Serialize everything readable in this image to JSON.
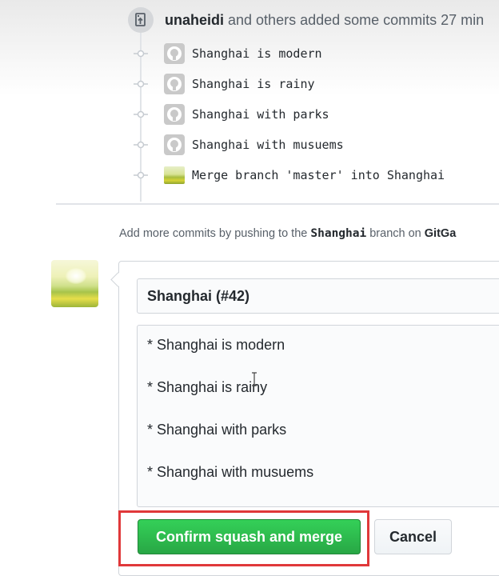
{
  "timeline": {
    "event_user": "unaheidi",
    "event_text": " and others added some commits 27 min",
    "commits": [
      {
        "message": "Shanghai is modern",
        "avatar": "github-octocat-icon"
      },
      {
        "message": "Shanghai is rainy",
        "avatar": "github-octocat-icon"
      },
      {
        "message": "Shanghai with parks",
        "avatar": "github-octocat-icon"
      },
      {
        "message": "Shanghai with musuems",
        "avatar": "github-octocat-icon"
      },
      {
        "message": "Merge branch 'master' into Shanghai",
        "avatar": "user-photo"
      }
    ]
  },
  "hint": {
    "prefix": "Add more commits by pushing to the ",
    "branch": "Shanghai",
    "middle": " branch on ",
    "remote": "GitGa"
  },
  "merge_form": {
    "title_value": "Shanghai (#42)",
    "body_lines": [
      "* Shanghai is modern",
      "* Shanghai is rainy",
      "* Shanghai with parks",
      "* Shanghai with musuems"
    ],
    "confirm_label": "Confirm squash and merge",
    "cancel_label": "Cancel"
  },
  "colors": {
    "confirm_green": "#2cbe4e",
    "highlight_red": "#e0383a"
  }
}
